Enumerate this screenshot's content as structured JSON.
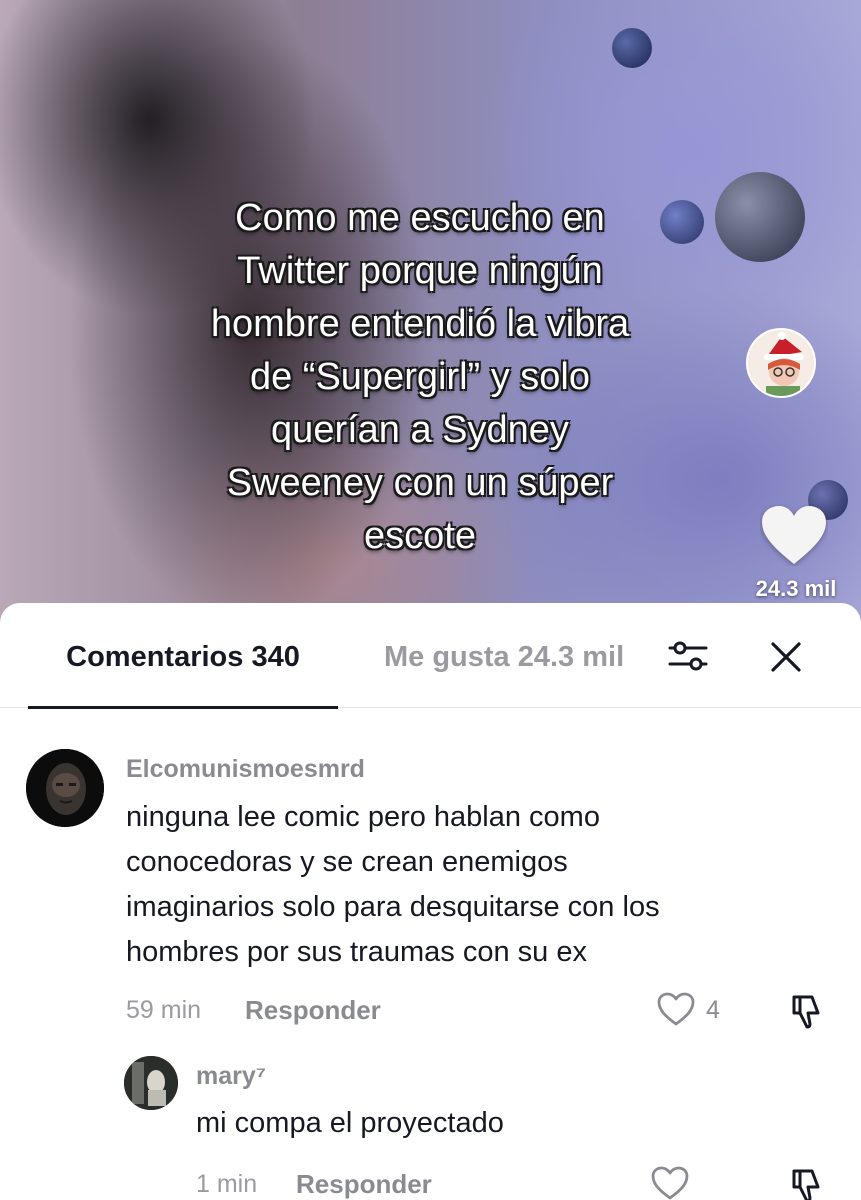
{
  "video": {
    "overlay_text": "Como me escucho en\nTwitter porque ningún\nhombre entendió la vibra\nde “Supergirl” y solo\nquerían a Sydney\nSweeney con un súper\nescote",
    "like_count": "24.3 mil"
  },
  "tabs": {
    "comments_label": "Comentarios 340",
    "likes_label": "Me gusta 24.3 mil"
  },
  "comments": [
    {
      "username": "Elcomunismoesmrd",
      "text": "ninguna lee comic pero hablan como\nconocedoras y se crean enemigos\nimaginarios solo para desquitarse con los\nhombres por sus traumas con su ex",
      "time": "59 min",
      "reply_label": "Responder",
      "likes": "4"
    },
    {
      "username": "mary⁷",
      "text": "mi compa el proyectado",
      "time": "1 min",
      "reply_label": "Responder"
    }
  ],
  "colors": {
    "text_primary": "#161823",
    "text_secondary": "#8a8b91",
    "divider": "#e4e4e4"
  }
}
